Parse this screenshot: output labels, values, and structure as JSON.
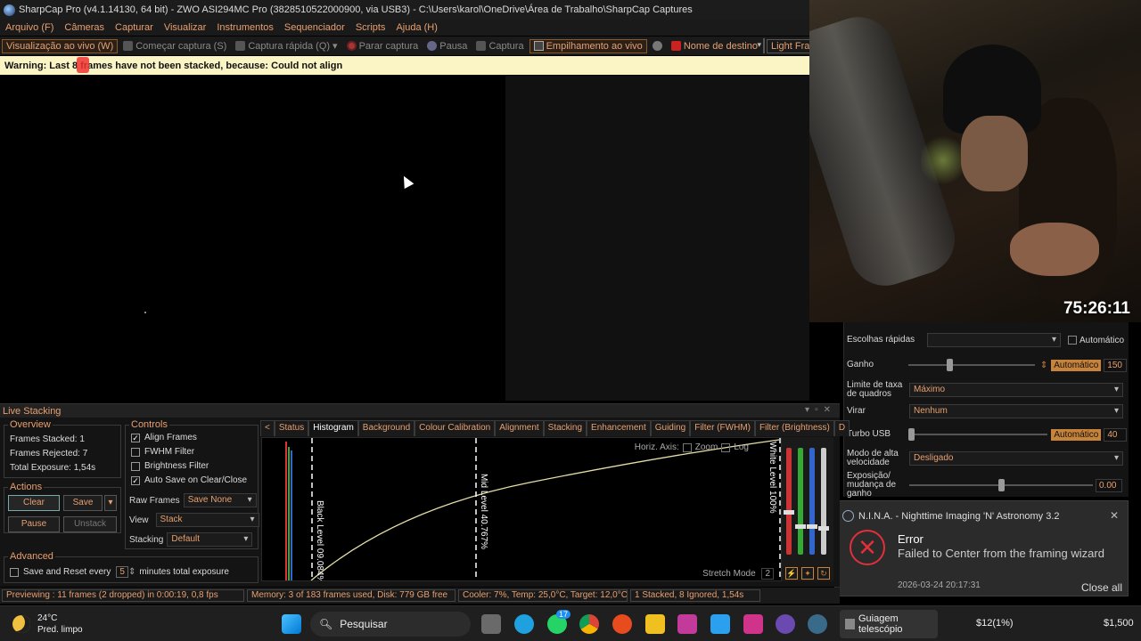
{
  "titlebar": {
    "title": "SharpCap Pro (v4.1.14130, 64 bit) - ZWO ASI294MC Pro (3828510522000900, via USB3) - C:\\Users\\karol\\OneDrive\\Área de Trabalho\\SharpCap Captures"
  },
  "menu": [
    "Arquivo (F)",
    "Câmeras",
    "Capturar",
    "Visualizar",
    "Instrumentos",
    "Sequenciador",
    "Scripts",
    "Ajuda (H)"
  ],
  "toolbar": {
    "live_view": "Visualização ao vivo (W)",
    "start_capture": "Começar captura (S)",
    "quick_capture": "Captura rápida (Q)",
    "stop_capture": "Parar captura",
    "pause": "Pausa",
    "capture": "Captura",
    "live_stacking": "Empilhamento ao vivo",
    "target_name": "Nome de destino",
    "frame_type": "Light Frames"
  },
  "warning": {
    "text": "Warning: Last 8 frames have not been stacked, because: Could not align"
  },
  "webcam": {
    "timer": "75:26:11"
  },
  "camera_panel": {
    "quick_picks": "Escolhas rápidas",
    "automatic": "Automático",
    "gain_label": "Ganho",
    "gain_auto": "Automático",
    "gain_value": "150",
    "gain_level": 0.32,
    "framerate_label": "Limite de taxa de quadros",
    "framerate_value": "Máximo",
    "flip_label": "Virar",
    "flip_value": "Nenhum",
    "usb_label": "Turbo USB",
    "usb_auto": "Automático",
    "usb_value": "40",
    "usb_level": 0.0,
    "hsm_label": "Modo de alta velocidade",
    "hsm_value": "Desligado",
    "exposure_label": "Exposição/ mudança de ganho",
    "exposure_value": "0.00",
    "exposure_level": 0.5
  },
  "notification": {
    "app": "N.I.N.A. - Nighttime Imaging 'N' Astronomy 3.2",
    "title": "Error",
    "message": "Failed to Center from the framing wizard",
    "time": "2026-03-24 20:17:31",
    "close_all": "Close all"
  },
  "live_stacking": {
    "title": "Live Stacking",
    "overview": {
      "title": "Overview",
      "stacked_label": "Frames Stacked:",
      "stacked_value": "1",
      "rejected_label": "Frames Rejected:",
      "rejected_value": "7",
      "exposure_label": "Total Exposure:",
      "exposure_value": "1,54s"
    },
    "actions": {
      "title": "Actions",
      "clear": "Clear",
      "save": "Save",
      "pause": "Pause",
      "unstack": "Unstack"
    },
    "advanced": {
      "title": "Advanced",
      "save_reset": "Save and Reset every",
      "minutes_value": "5",
      "minutes_suffix": "minutes total exposure"
    },
    "controls": {
      "title": "Controls",
      "align": "Align Frames",
      "fwhm": "FWHM Filter",
      "brightness": "Brightness Filter",
      "autosave": "Auto Save on Clear/Close",
      "raw_frames_label": "Raw Frames",
      "raw_frames_value": "Save None",
      "view_label": "View",
      "view_value": "Stack",
      "stacking_label": "Stacking",
      "stacking_value": "Default"
    },
    "tabs": [
      "<",
      "Status",
      "Histogram",
      "Background",
      "Colour Calibration",
      "Alignment",
      "Stacking",
      "Enhancement",
      "Guiding",
      "Filter (FWHM)",
      "Filter (Brightness)",
      "D"
    ],
    "active_tab": "Histogram",
    "histogram": {
      "horiz_axis": "Horiz. Axis:",
      "zoom": "Zoom",
      "log": "Log",
      "black_level": "Black Level 09.084%",
      "mid_level": "Mid Level 40.767%",
      "white_level": "White Level 100%",
      "stretch_mode": "Stretch Mode",
      "stretch_value": "2"
    }
  },
  "statusbar": {
    "previewing": "Previewing : 11 frames (2 dropped) in 0:00:19, 0,8 fps",
    "memory": "Memory: 3 of 183 frames used, Disk: 779 GB free",
    "cooler": "Cooler: 7%, Temp: 25,0°C, Target: 12,0°C",
    "stacked": "1 Stacked, 8 Ignored, 1,54s"
  },
  "taskbar": {
    "temp": "24°C",
    "weather": "Pred. limpo",
    "search": "Pesquisar",
    "app": "Guiagem telescópio",
    "ticker1": "$12(1%)",
    "ticker2": "$1,500",
    "whatsapp_badge": "17"
  }
}
